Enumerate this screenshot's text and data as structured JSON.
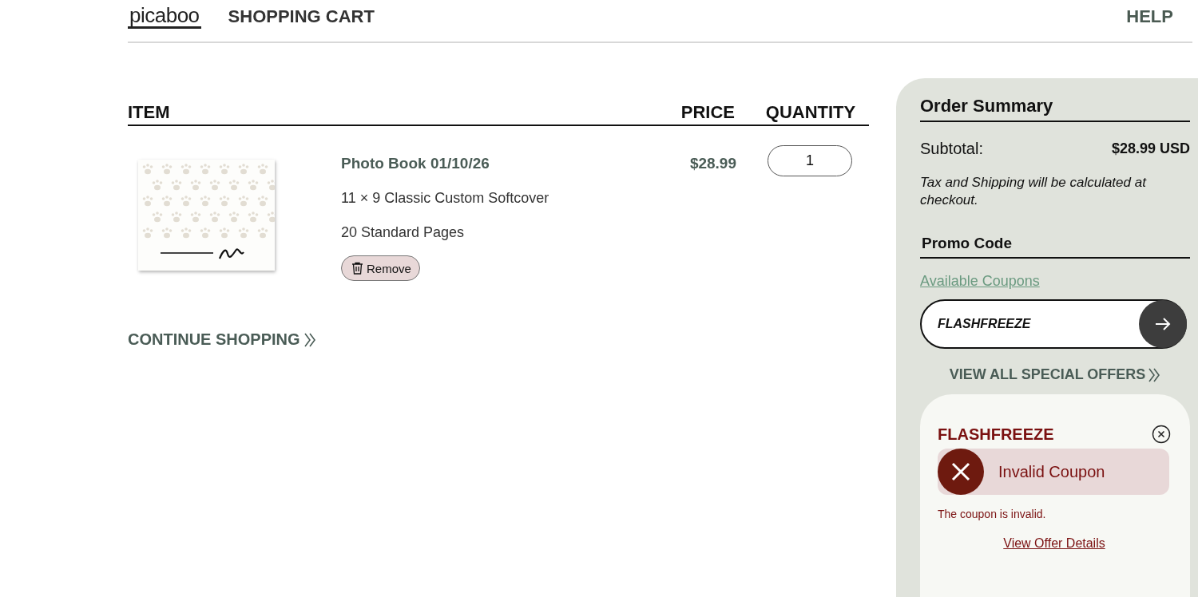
{
  "header": {
    "logo": "picaboo",
    "title": "SHOPPING CART",
    "help": "HELP"
  },
  "cart": {
    "columns": [
      "ITEM",
      "PRICE",
      "QUANTITY"
    ],
    "items": [
      {
        "thumbnail": {
          "kind": "picture"
        },
        "name": "Photo Book 01/10/26",
        "details": [
          "11 × 9 Classic Custom Softcover",
          "20 Standard Pages"
        ],
        "remove": "Remove",
        "price": "$28.99",
        "quantity": "1"
      }
    ],
    "continue": "CONTINUE SHOPPING"
  },
  "summary": {
    "title": "Order Summary",
    "subtotal_label": "Subtotal:",
    "subtotal": "$28.99 USD",
    "note": "Tax and Shipping will be calculated at checkout.",
    "promo_title": "Promo Code",
    "coupons_link": "Available Coupons",
    "promo_value": "FLASHFREEZE",
    "offers_link": "VIEW ALL SPECIAL OFFERS",
    "coupon": {
      "code": "FLASHFREEZE",
      "valid": false,
      "status": "Invalid Coupon",
      "message": "The coupon is invalid.",
      "link": "View Offer Details"
    }
  }
}
